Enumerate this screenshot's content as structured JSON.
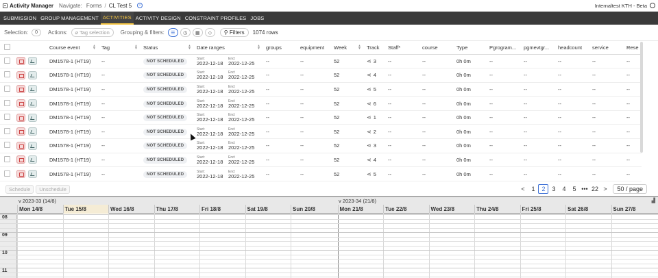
{
  "header": {
    "app_title": "Activity Manager",
    "nav_label": "Navigate:",
    "crumbs": [
      "Forms",
      "CL Test 5"
    ],
    "env": "Internaltest KTH - Beta"
  },
  "navtabs": [
    "SUBMISSION",
    "GROUP MANAGEMENT",
    "ACTIVITIES",
    "ACTIVITY DESIGN",
    "CONSTRAINT PROFILES",
    "JOBS"
  ],
  "active_tab": "ACTIVITIES",
  "toolbar": {
    "selection_label": "Selection:",
    "selection_count": "0",
    "actions_label": "Actions:",
    "tag_selection": "Tag selection",
    "grouping_label": "Grouping & filters:",
    "filters": "Filters",
    "rows": "1074 rows"
  },
  "table": {
    "columns": [
      "Course event",
      "Tag",
      "Status",
      "Date ranges",
      "groups",
      "equipment",
      "Week",
      "Track",
      "Staff*",
      "course",
      "Type",
      "Pgrogram...",
      "pgmevtgr...",
      "headcount",
      "service",
      "Rese"
    ],
    "rows": [
      {
        "course": "DM1578-1 (HT19)",
        "tag": "--",
        "status": "NOT SCHEDULED",
        "start_label": "Start:",
        "start": "2022-12-18",
        "end_label": "End:",
        "end": "2022-12-25",
        "groups": "--",
        "equipment": "--",
        "week": "52",
        "track": "3",
        "staff": "--",
        "coursecol": "--",
        "type": "0h 0m",
        "prog": "--",
        "pgmevt": "--",
        "headcount": "--",
        "service": "--",
        "rese": "--"
      },
      {
        "course": "DM1578-1 (HT19)",
        "tag": "--",
        "status": "NOT SCHEDULED",
        "start_label": "Start:",
        "start": "2022-12-18",
        "end_label": "End:",
        "end": "2022-12-25",
        "groups": "--",
        "equipment": "--",
        "week": "52",
        "track": "4",
        "staff": "--",
        "coursecol": "--",
        "type": "0h 0m",
        "prog": "--",
        "pgmevt": "--",
        "headcount": "--",
        "service": "--",
        "rese": "--"
      },
      {
        "course": "DM1578-1 (HT19)",
        "tag": "--",
        "status": "NOT SCHEDULED",
        "start_label": "Start:",
        "start": "2022-12-18",
        "end_label": "End:",
        "end": "2022-12-25",
        "groups": "--",
        "equipment": "--",
        "week": "52",
        "track": "5",
        "staff": "--",
        "coursecol": "--",
        "type": "0h 0m",
        "prog": "--",
        "pgmevt": "--",
        "headcount": "--",
        "service": "--",
        "rese": "--"
      },
      {
        "course": "DM1578-1 (HT19)",
        "tag": "--",
        "status": "NOT SCHEDULED",
        "start_label": "Start:",
        "start": "2022-12-18",
        "end_label": "End:",
        "end": "2022-12-25",
        "groups": "--",
        "equipment": "--",
        "week": "52",
        "track": "6",
        "staff": "--",
        "coursecol": "--",
        "type": "0h 0m",
        "prog": "--",
        "pgmevt": "--",
        "headcount": "--",
        "service": "--",
        "rese": "--"
      },
      {
        "course": "DM1578-1 (HT19)",
        "tag": "--",
        "status": "NOT SCHEDULED",
        "start_label": "Start:",
        "start": "2022-12-18",
        "end_label": "End:",
        "end": "2022-12-25",
        "groups": "--",
        "equipment": "--",
        "week": "52",
        "track": "1",
        "staff": "--",
        "coursecol": "--",
        "type": "0h 0m",
        "prog": "--",
        "pgmevt": "--",
        "headcount": "--",
        "service": "--",
        "rese": "--"
      },
      {
        "course": "DM1578-1 (HT19)",
        "tag": "--",
        "status": "NOT SCHEDULED",
        "start_label": "Start:",
        "start": "2022-12-18",
        "end_label": "End:",
        "end": "2022-12-25",
        "groups": "--",
        "equipment": "--",
        "week": "52",
        "track": "2",
        "staff": "--",
        "coursecol": "--",
        "type": "0h 0m",
        "prog": "--",
        "pgmevt": "--",
        "headcount": "--",
        "service": "--",
        "rese": "--"
      },
      {
        "course": "DM1578-1 (HT19)",
        "tag": "--",
        "status": "NOT SCHEDULED",
        "start_label": "Start:",
        "start": "2022-12-18",
        "end_label": "End:",
        "end": "2022-12-25",
        "groups": "--",
        "equipment": "--",
        "week": "52",
        "track": "3",
        "staff": "--",
        "coursecol": "--",
        "type": "0h 0m",
        "prog": "--",
        "pgmevt": "--",
        "headcount": "--",
        "service": "--",
        "rese": "--"
      },
      {
        "course": "DM1578-1 (HT19)",
        "tag": "--",
        "status": "NOT SCHEDULED",
        "start_label": "Start:",
        "start": "2022-12-18",
        "end_label": "End:",
        "end": "2022-12-25",
        "groups": "--",
        "equipment": "--",
        "week": "52",
        "track": "4",
        "staff": "--",
        "coursecol": "--",
        "type": "0h 0m",
        "prog": "--",
        "pgmevt": "--",
        "headcount": "--",
        "service": "--",
        "rese": "--"
      },
      {
        "course": "DM1578-1 (HT19)",
        "tag": "--",
        "status": "NOT SCHEDULED",
        "start_label": "Start:",
        "start": "2022-12-18",
        "end_label": "End:",
        "end": "2022-12-25",
        "groups": "--",
        "equipment": "--",
        "week": "52",
        "track": "5",
        "staff": "--",
        "coursecol": "--",
        "type": "0h 0m",
        "prog": "--",
        "pgmevt": "--",
        "headcount": "--",
        "service": "--",
        "rese": "--"
      }
    ]
  },
  "footer": {
    "schedule": "Schedule",
    "unschedule": "Unschedule",
    "pages": [
      "1",
      "2",
      "3",
      "4",
      "5",
      "•••",
      "22"
    ],
    "active_page": "2",
    "prev": "<",
    "next": ">",
    "page_size": "50 / page"
  },
  "calendar": {
    "weeks": [
      "v 2023-33 (14/8)",
      "v 2023-34 (21/8)"
    ],
    "days": [
      "Mon 14/8",
      "Tue 15/8",
      "Wed 16/8",
      "Thu 17/8",
      "Fri 18/8",
      "Sat 19/8",
      "Sun 20/8",
      "Mon 21/8",
      "Tue 22/8",
      "Wed 23/8",
      "Thu 24/8",
      "Fri 25/8",
      "Sat 26/8",
      "Sun 27/8"
    ],
    "hours": [
      "08",
      "09",
      "10",
      "11"
    ],
    "today_index": 1
  },
  "colors": {
    "nav_bg": "#3a3a3a",
    "active_tab": "#f5c542",
    "accent": "#3b6fd6",
    "today": "#f5ecd5"
  }
}
